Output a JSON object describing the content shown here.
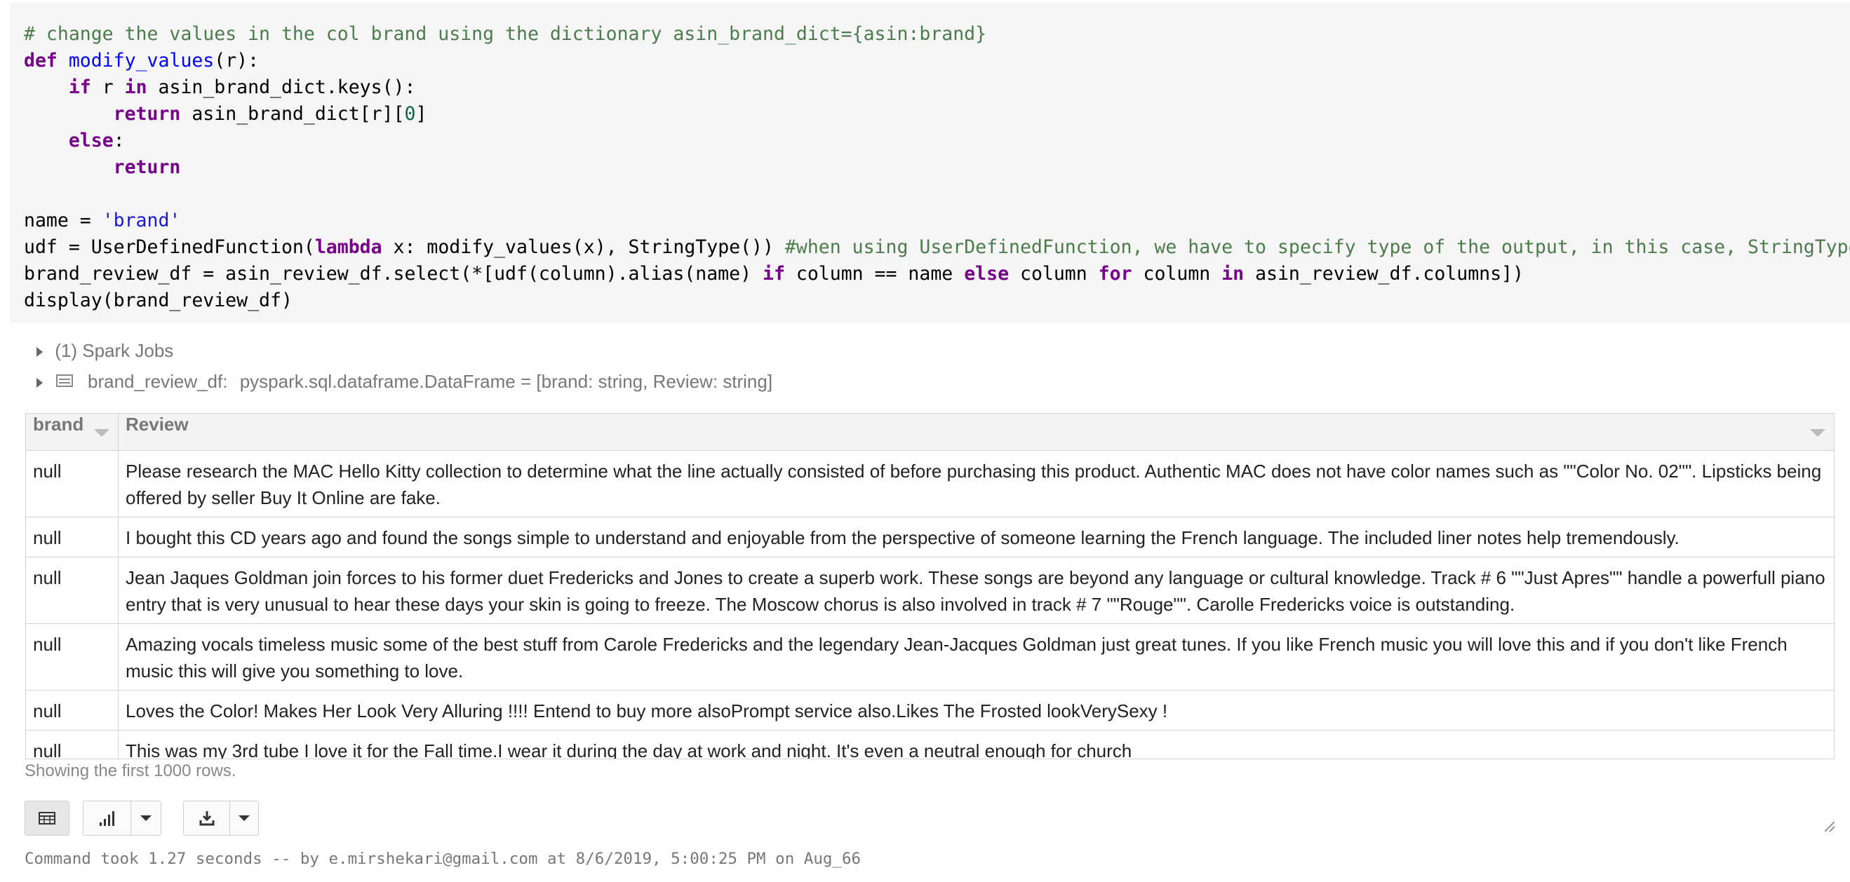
{
  "code": {
    "comment1": "# change the values in the col brand using the dictionary asin_brand_dict={asin:brand}",
    "l2_def": "def",
    "l2_fn": "modify_values",
    "l2_rest": "(r):",
    "l3_if": "if",
    "l3_mid": " r ",
    "l3_in": "in",
    "l3_rest": " asin_brand_dict.keys():",
    "l4_return": "return",
    "l4_rest": " asin_brand_dict[r][",
    "l4_num": "0",
    "l4_end": "]",
    "l5_else": "else",
    "l5_rest": ":",
    "l6_return": "return",
    "l8_a": "name = ",
    "l8_str": "'brand'",
    "l9_a": "udf = UserDefinedFunction(",
    "l9_lambda": "lambda",
    "l9_b": " x: modify_values(x), StringType()) ",
    "l9_comment": "#when using UserDefinedFunction, we have to specify type of the output, in this case, StringType()",
    "l10_a": "brand_review_df = asin_review_df.select(*[udf(column).alias(name) ",
    "l10_if": "if",
    "l10_b": " column == name ",
    "l10_else": "else",
    "l10_c": " column ",
    "l10_for": "for",
    "l10_d": " column ",
    "l10_in": "in",
    "l10_e": " asin_review_df.columns])",
    "l11": "display(brand_review_df)"
  },
  "spark_jobs": "(1) Spark Jobs",
  "df_schema": {
    "name": "brand_review_df:",
    "type": "pyspark.sql.dataframe.DataFrame = [brand: string, Review: string]"
  },
  "table": {
    "headers": [
      "brand",
      "Review"
    ],
    "rows": [
      [
        "null",
        "Please research the MAC Hello Kitty collection to determine what the line actually consisted of before purchasing this product.  Authentic MAC does not have color names such as \"\"Color No. 02\"\".  Lipsticks being offered by seller Buy It Online are fake."
      ],
      [
        "null",
        "I bought this CD years ago and found the songs simple to understand and enjoyable from the perspective of someone learning the French language. The included liner notes help tremendously."
      ],
      [
        "null",
        "Jean Jaques Goldman join forces to his former duet Fredericks and Jones to create a superb work. These songs are beyond any language or cultural knowledge. Track # 6 \"\"Just Apres\"\" handle a powerfull piano entry that is very unusual to hear these days your skin is going to freeze. The Moscow chorus is also involved in track # 7 \"\"Rouge\"\". Carolle Fredericks voice is outstanding."
      ],
      [
        "null",
        "Amazing vocals timeless music some of the best stuff from Carole Fredericks and the legendary Jean-Jacques Goldman just great tunes.  If you like French music you will love this and if you don't like French music this will give you something to love."
      ],
      [
        "null",
        "Loves the Color! Makes Her Look Very Alluring !!!! Entend to buy more alsoPrompt service also.Likes The Frosted lookVerySexy !"
      ],
      [
        "null",
        "This was my 3rd tube I love it for the Fall time.I wear it during the day at work and night. It's even a neutral enough for church"
      ]
    ]
  },
  "footer_note": "Showing the first 1000 rows.",
  "toolbar": {
    "table_icon": "table-icon",
    "chart_icon": "bar-chart-icon",
    "download_icon": "download-icon"
  },
  "command_status": "Command took 1.27 seconds -- by e.mirshekari@gmail.com at 8/6/2019, 5:00:25 PM on Aug_66"
}
